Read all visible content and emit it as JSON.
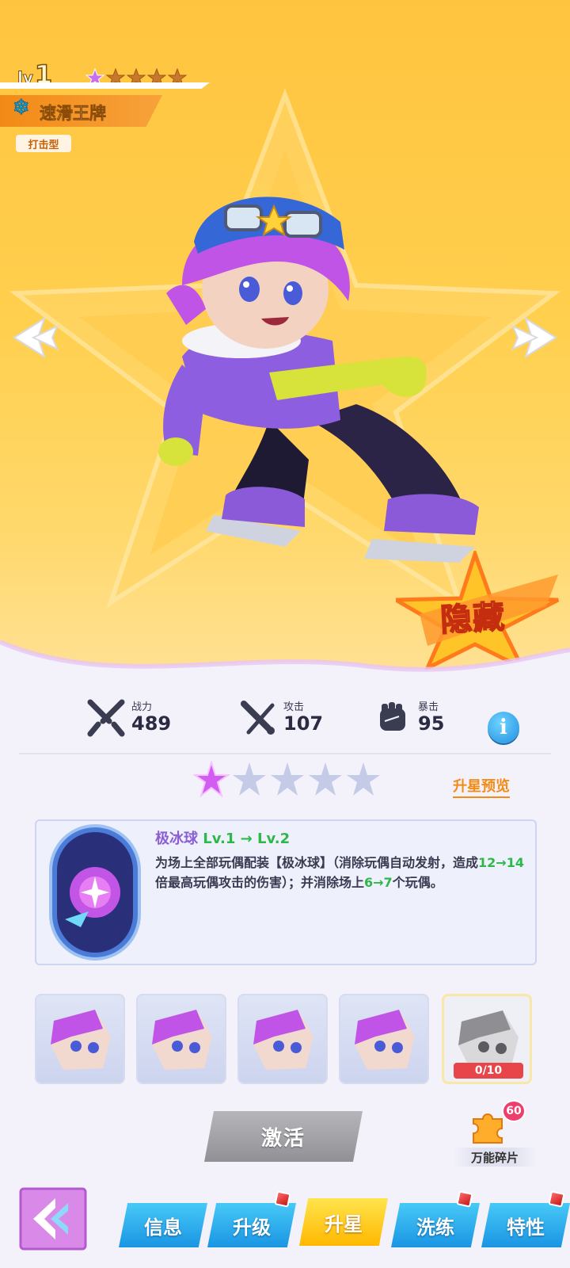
{
  "hero": {
    "level_prefix": "lv",
    "level": "1",
    "star_count": 1,
    "star_total": 5,
    "name_icon": "❄",
    "name": "速滑王牌",
    "type_tag": "打击型",
    "rarity_badge": "隐藏"
  },
  "stats": {
    "power": {
      "label": "战力",
      "value": "489"
    },
    "attack": {
      "label": "攻击",
      "value": "107"
    },
    "crit": {
      "label": "暴击",
      "value": "95"
    }
  },
  "star_upgrade": {
    "filled": 1,
    "total": 5,
    "preview_label": "升星预览"
  },
  "skill": {
    "name": "极冰球",
    "level_change": "Lv.1 → Lv.2",
    "desc_part1": "为场上全部玩偶配装【极冰球】（消除玩偶自动发射，造成",
    "desc_val1": "12→14",
    "desc_part2": "倍最高玩偶攻击的伤害）；并消除场上",
    "desc_val2": "6→7",
    "desc_part3": "个玩偶。"
  },
  "fragments": {
    "progress": "0/10"
  },
  "actions": {
    "activate": "激活",
    "universal_label": "万能碎片",
    "universal_count": "60"
  },
  "tabs": [
    {
      "label": "信息"
    },
    {
      "label": "升级"
    },
    {
      "label": "升星"
    },
    {
      "label": "洗练"
    },
    {
      "label": "特性"
    }
  ],
  "colors": {
    "hero_bg": "#ffc43f",
    "tab_blue": "#1a95e3",
    "tab_active": "#ffb800",
    "green_value": "#2fb84a",
    "skill_name": "#8a5fd6",
    "accent_orange": "#f58a14"
  }
}
